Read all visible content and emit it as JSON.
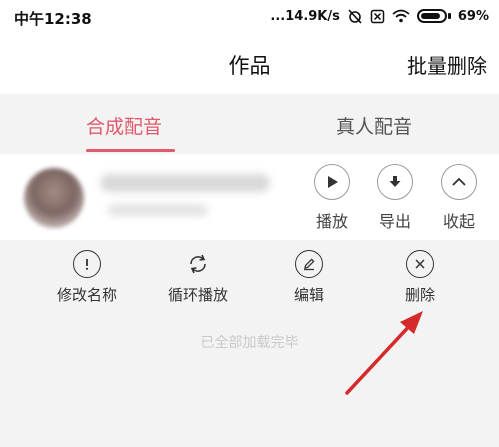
{
  "status_bar": {
    "time": "中午12:38",
    "net_speed": "...14.9K/s",
    "battery": "69%"
  },
  "header": {
    "title": "作品",
    "batch_delete": "批量删除"
  },
  "tabs": [
    {
      "label": "合成配音",
      "active": true
    },
    {
      "label": "真人配音",
      "active": false
    }
  ],
  "work_item": {
    "actions": [
      {
        "label": "播放",
        "icon": "play-icon"
      },
      {
        "label": "导出",
        "icon": "download-icon"
      },
      {
        "label": "收起",
        "icon": "chevron-up-icon"
      }
    ],
    "operations": [
      {
        "label": "修改名称",
        "icon": "exclamation-icon"
      },
      {
        "label": "循环播放",
        "icon": "loop-icon"
      },
      {
        "label": "编辑",
        "icon": "pencil-icon"
      },
      {
        "label": "删除",
        "icon": "close-icon"
      }
    ]
  },
  "list_footer": "已全部加载完毕",
  "colors": {
    "accent": "#e05a6c",
    "annotation_arrow": "#d42a2a"
  }
}
